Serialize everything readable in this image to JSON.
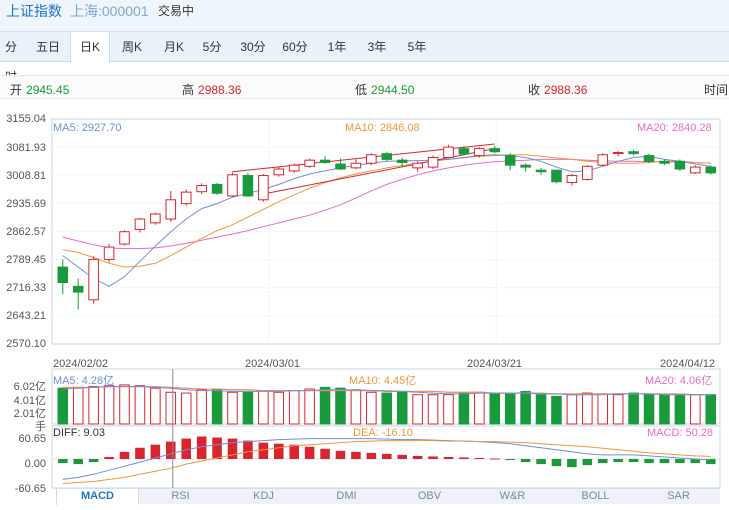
{
  "header": {
    "name": "上证指数",
    "code": "上海:000001",
    "status": "交易中"
  },
  "period_tabs": [
    "分时",
    "五日",
    "日K",
    "周K",
    "月K",
    "5分",
    "30分",
    "60分",
    "1年",
    "3年",
    "5年"
  ],
  "active_period": "日K",
  "quote": {
    "open_label": "开",
    "open": "2945.45",
    "high_label": "高",
    "high": "2988.36",
    "low_label": "低",
    "low": "2944.50",
    "close_label": "收",
    "close": "2988.36",
    "time_label": "时间"
  },
  "price_axis": [
    "3155.04",
    "3081.93",
    "3008.81",
    "2935.69",
    "2862.57",
    "2789.45",
    "2716.33",
    "2643.21",
    "2570.10"
  ],
  "dates": [
    "2024/02/02",
    "2024/03/01",
    "2024/03/21",
    "2024/04/12"
  ],
  "ma_labels": {
    "ma5": "MA5: 2927.70",
    "ma10": "MA10: 2846.08",
    "ma20": "MA20: 2840.28"
  },
  "volume": {
    "axis": [
      "6.02亿",
      "4.01亿",
      "2.01亿"
    ],
    "unit": "手",
    "ma5": "MA5: 4.28亿",
    "ma10": "MA10: 4.45亿",
    "ma20": "MA20: 4.06亿"
  },
  "macd": {
    "axis": [
      "60.65",
      "0.00",
      "-60.65"
    ],
    "diff": "DIFF: 9.03",
    "dea": "DEA: -16.10",
    "macd": "MACD: 50.28"
  },
  "indicator_tabs": [
    "MACD",
    "RSI",
    "KDJ",
    "DMI",
    "OBV",
    "W&R",
    "BOLL",
    "SAR"
  ],
  "active_indicator": "MACD",
  "colors": {
    "up": "#d9252e",
    "down": "#1a9a3c",
    "ma5": "#6e8fd8",
    "ma10": "#f0953c",
    "ma20": "#e96ac7",
    "accent": "#1e74c6"
  },
  "chart_data": {
    "type": "candlestick",
    "ylim": [
      2570.1,
      3155.04
    ],
    "candles": [
      {
        "o": 2770,
        "c": 2730,
        "h": 2790,
        "l": 2700
      },
      {
        "o": 2720,
        "c": 2705,
        "h": 2740,
        "l": 2660
      },
      {
        "o": 2685,
        "c": 2790,
        "h": 2798,
        "l": 2675
      },
      {
        "o": 2790,
        "c": 2822,
        "h": 2830,
        "l": 2782
      },
      {
        "o": 2830,
        "c": 2862,
        "h": 2866,
        "l": 2826
      },
      {
        "o": 2868,
        "c": 2895,
        "h": 2898,
        "l": 2860
      },
      {
        "o": 2885,
        "c": 2908,
        "h": 2912,
        "l": 2880
      },
      {
        "o": 2895,
        "c": 2945,
        "h": 2968,
        "l": 2888
      },
      {
        "o": 2935,
        "c": 2965,
        "h": 2972,
        "l": 2930
      },
      {
        "o": 2966,
        "c": 2982,
        "h": 2988,
        "l": 2960
      },
      {
        "o": 2985,
        "c": 2962,
        "h": 2989,
        "l": 2958
      },
      {
        "o": 2955,
        "c": 3010,
        "h": 3016,
        "l": 2952
      },
      {
        "o": 3008,
        "c": 2955,
        "h": 3015,
        "l": 2952
      },
      {
        "o": 2945,
        "c": 3008,
        "h": 3012,
        "l": 2940
      },
      {
        "o": 3010,
        "c": 3025,
        "h": 3030,
        "l": 3005
      },
      {
        "o": 3020,
        "c": 3035,
        "h": 3040,
        "l": 3015
      },
      {
        "o": 3032,
        "c": 3048,
        "h": 3052,
        "l": 3028
      },
      {
        "o": 3048,
        "c": 3042,
        "h": 3058,
        "l": 3038
      },
      {
        "o": 3038,
        "c": 3025,
        "h": 3052,
        "l": 3022
      },
      {
        "o": 3028,
        "c": 3040,
        "h": 3050,
        "l": 3024
      },
      {
        "o": 3040,
        "c": 3062,
        "h": 3066,
        "l": 3035
      },
      {
        "o": 3065,
        "c": 3050,
        "h": 3070,
        "l": 3045
      },
      {
        "o": 3048,
        "c": 3042,
        "h": 3055,
        "l": 3030
      },
      {
        "o": 3028,
        "c": 3040,
        "h": 3045,
        "l": 3018
      },
      {
        "o": 3030,
        "c": 3055,
        "h": 3060,
        "l": 3025
      },
      {
        "o": 3055,
        "c": 3082,
        "h": 3088,
        "l": 3052
      },
      {
        "o": 3078,
        "c": 3064,
        "h": 3085,
        "l": 3060
      },
      {
        "o": 3060,
        "c": 3078,
        "h": 3082,
        "l": 3055
      },
      {
        "o": 3078,
        "c": 3070,
        "h": 3086,
        "l": 3066
      },
      {
        "o": 3060,
        "c": 3035,
        "h": 3066,
        "l": 3022
      },
      {
        "o": 3035,
        "c": 3030,
        "h": 3040,
        "l": 3018
      },
      {
        "o": 3022,
        "c": 3018,
        "h": 3028,
        "l": 3010
      },
      {
        "o": 3022,
        "c": 2992,
        "h": 3024,
        "l": 2988
      },
      {
        "o": 2990,
        "c": 3008,
        "h": 3012,
        "l": 2982
      },
      {
        "o": 2998,
        "c": 3032,
        "h": 3035,
        "l": 2995
      },
      {
        "o": 3035,
        "c": 3062,
        "h": 3066,
        "l": 3032
      },
      {
        "o": 3068,
        "c": 3068,
        "h": 3072,
        "l": 3058
      },
      {
        "o": 3070,
        "c": 3065,
        "h": 3075,
        "l": 3060
      },
      {
        "o": 3060,
        "c": 3045,
        "h": 3065,
        "l": 3040
      },
      {
        "o": 3045,
        "c": 3040,
        "h": 3050,
        "l": 3035
      },
      {
        "o": 3045,
        "c": 3025,
        "h": 3050,
        "l": 3020
      },
      {
        "o": 3015,
        "c": 3030,
        "h": 3035,
        "l": 3012
      },
      {
        "o": 3030,
        "c": 3015,
        "h": 3034,
        "l": 3010
      }
    ],
    "ma5": [
      2800,
      2770,
      2740,
      2720,
      2745,
      2785,
      2825,
      2862,
      2895,
      2922,
      2935,
      2952,
      2962,
      2972,
      2985,
      3000,
      3012,
      3020,
      3028,
      3035,
      3040,
      3045,
      3046,
      3047,
      3048,
      3050,
      3055,
      3060,
      3062,
      3060,
      3055,
      3045,
      3030,
      3018,
      3020,
      3032,
      3045,
      3055,
      3058,
      3050,
      3045,
      3038,
      3032
    ],
    "ma10": [
      2815,
      2808,
      2795,
      2780,
      2770,
      2772,
      2780,
      2800,
      2822,
      2845,
      2865,
      2880,
      2900,
      2920,
      2940,
      2958,
      2975,
      2990,
      3002,
      3012,
      3020,
      3028,
      3034,
      3040,
      3045,
      3050,
      3054,
      3058,
      3060,
      3062,
      3062,
      3058,
      3054,
      3050,
      3045,
      3042,
      3040,
      3040,
      3042,
      3045,
      3045,
      3042,
      3040
    ],
    "ma20": [
      2848,
      2838,
      2828,
      2820,
      2818,
      2818,
      2820,
      2825,
      2832,
      2840,
      2848,
      2856,
      2865,
      2875,
      2885,
      2895,
      2905,
      2918,
      2932,
      2950,
      2968,
      2985,
      2998,
      3010,
      3020,
      3028,
      3035,
      3040,
      3044,
      3046,
      3048,
      3050,
      3050,
      3050,
      3048,
      3046,
      3045,
      3045,
      3044,
      3044,
      3043,
      3042,
      3040
    ],
    "trendline_upper": {
      "from_index": 11,
      "from_value": 3018,
      "to_index": 28,
      "to_value": 3090
    },
    "trendline_lower": {
      "from_index": 13,
      "from_value": 2960,
      "to_index": 28,
      "to_value": 3078
    },
    "volume_values": [
      4.4,
      4.5,
      4.6,
      4.7,
      4.8,
      4.7,
      4.4,
      3.9,
      3.8,
      4.2,
      4.2,
      3.9,
      3.9,
      4.1,
      3.9,
      4.1,
      4.3,
      4.5,
      4.4,
      4.2,
      3.9,
      3.8,
      4.0,
      3.6,
      3.6,
      3.6,
      3.8,
      3.9,
      3.8,
      3.8,
      4.0,
      3.6,
      3.4,
      3.6,
      3.8,
      3.7,
      3.6,
      3.8,
      3.6,
      3.6,
      3.6,
      3.6,
      3.6
    ],
    "volume_up": [
      false,
      true,
      true,
      true,
      true,
      true,
      true,
      true,
      true,
      true,
      false,
      true,
      false,
      true,
      true,
      true,
      true,
      false,
      false,
      true,
      true,
      false,
      false,
      true,
      true,
      true,
      false,
      true,
      false,
      false,
      false,
      false,
      false,
      true,
      true,
      true,
      true,
      false,
      false,
      false,
      false,
      true,
      false
    ],
    "vol_ma5": [
      4.3,
      4.4,
      4.5,
      4.6,
      4.6,
      4.6,
      4.5,
      4.4,
      4.2,
      4.1,
      4.1,
      4.0,
      4.0,
      4.0,
      4.0,
      4.1,
      4.1,
      4.2,
      4.2,
      4.2,
      4.1,
      4.0,
      4.0,
      3.9,
      3.8,
      3.7,
      3.7,
      3.8,
      3.8,
      3.8,
      3.8,
      3.7,
      3.7,
      3.6,
      3.6,
      3.6,
      3.7,
      3.7,
      3.7,
      3.6,
      3.6,
      3.6,
      3.6
    ],
    "vol_ma10": [
      4.5,
      4.5,
      4.5,
      4.6,
      4.6,
      4.6,
      4.6,
      4.5,
      4.4,
      4.3,
      4.3,
      4.2,
      4.2,
      4.1,
      4.1,
      4.1,
      4.1,
      4.1,
      4.1,
      4.1,
      4.1,
      4.1,
      4.0,
      4.0,
      4.0,
      3.9,
      3.9,
      3.9,
      3.8,
      3.8,
      3.8,
      3.8,
      3.7,
      3.7,
      3.7,
      3.7,
      3.7,
      3.7,
      3.7,
      3.7,
      3.7,
      3.6,
      3.6
    ],
    "vol_ylim": [
      0,
      6.02
    ],
    "macd_values": [
      -8,
      -10,
      -6,
      4,
      14,
      22,
      28,
      34,
      40,
      44,
      42,
      40,
      36,
      32,
      30,
      28,
      24,
      20,
      16,
      14,
      12,
      10,
      8,
      6,
      5,
      4,
      3,
      2,
      1,
      -2,
      -6,
      -10,
      -14,
      -16,
      -12,
      -8,
      -6,
      -6,
      -8,
      -8,
      -8,
      -8,
      -10
    ],
    "diff": [
      -40,
      -36,
      -30,
      -22,
      -14,
      -6,
      2,
      10,
      18,
      24,
      28,
      32,
      34,
      36,
      38,
      39,
      40,
      40,
      40,
      40,
      40,
      39,
      38,
      38,
      37,
      36,
      35,
      34,
      32,
      30,
      26,
      22,
      18,
      14,
      10,
      8,
      8,
      8,
      6,
      4,
      2,
      0,
      -2
    ],
    "dea": [
      -48,
      -46,
      -44,
      -40,
      -36,
      -30,
      -24,
      -18,
      -10,
      -4,
      2,
      8,
      14,
      18,
      22,
      26,
      28,
      30,
      32,
      34,
      35,
      36,
      36,
      36,
      36,
      35,
      35,
      34,
      34,
      33,
      32,
      30,
      28,
      26,
      24,
      21,
      18,
      15,
      12,
      10,
      8,
      6,
      5
    ],
    "macd_ylim": [
      -60.65,
      60.65
    ]
  }
}
